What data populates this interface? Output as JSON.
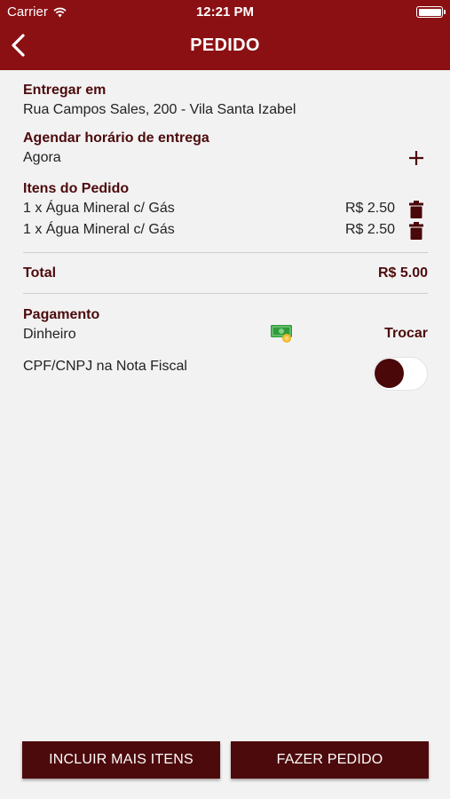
{
  "status_bar": {
    "carrier": "Carrier",
    "time": "12:21 PM"
  },
  "header": {
    "title": "PEDIDO"
  },
  "delivery": {
    "label": "Entregar em",
    "address": "Rua Campos Sales, 200 - Vila Santa Izabel"
  },
  "schedule": {
    "label": "Agendar horário de entrega",
    "value": "Agora"
  },
  "items": {
    "label": "Itens do Pedido",
    "list": [
      {
        "name": "1 x Água Mineral c/ Gás",
        "price": "R$ 2.50"
      },
      {
        "name": "1 x Água Mineral c/ Gás",
        "price": "R$ 2.50"
      }
    ]
  },
  "total": {
    "label": "Total",
    "value": "R$ 5.00"
  },
  "payment": {
    "label": "Pagamento",
    "method": "Dinheiro",
    "change_label": "Trocar"
  },
  "cpf": {
    "label": "CPF/CNPJ na Nota Fiscal",
    "enabled": false
  },
  "buttons": {
    "add_more": "INCLUIR MAIS ITENS",
    "place_order": "FAZER PEDIDO"
  },
  "colors": {
    "header": "#8b1014",
    "accent": "#4d0a0c",
    "background": "#f2f2f2"
  }
}
